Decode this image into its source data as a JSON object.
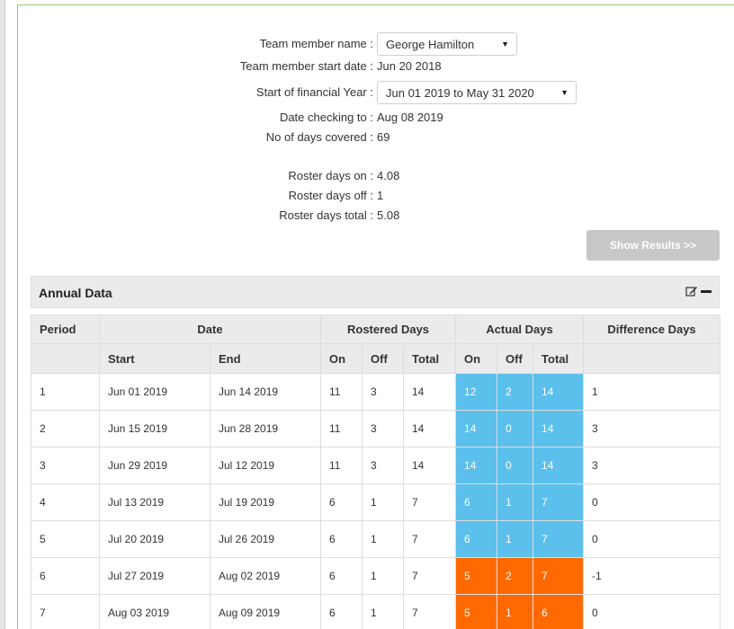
{
  "form": {
    "member_name_label": "Team member name :",
    "member_name_value": "George Hamilton",
    "start_date_label": "Team member start date :",
    "start_date_value": "Jun 20 2018",
    "financial_year_label": "Start of financial Year :",
    "financial_year_value": "Jun 01 2019 to May 31 2020",
    "date_checking_label": "Date checking to :",
    "date_checking_value": "Aug 08 2019",
    "days_covered_label": "No of days covered :",
    "days_covered_value": "69",
    "roster_on_label": "Roster days on :",
    "roster_on_value": "4.08",
    "roster_off_label": "Roster days off :",
    "roster_off_value": "1",
    "roster_total_label": "Roster days total :",
    "roster_total_value": "5.08",
    "caret_icon": "▼"
  },
  "buttons": {
    "show_results": "Show Results >>"
  },
  "panel": {
    "title": "Annual Data",
    "edit_icon": "edit-icon",
    "collapse_icon": "minus-icon"
  },
  "colors": {
    "actual_over": "#5bc0eb",
    "actual_under": "#ff6900",
    "frame": "#8fce6b"
  },
  "table": {
    "group_headers": {
      "period": "Period",
      "date": "Date",
      "rostered": "Rostered Days",
      "actual": "Actual Days",
      "difference": "Difference Days"
    },
    "sub_headers": {
      "start": "Start",
      "end": "End",
      "r_on": "On",
      "r_off": "Off",
      "r_total": "Total",
      "a_on": "On",
      "a_off": "Off",
      "a_total": "Total"
    },
    "rows": [
      {
        "period": "1",
        "start": "Jun 01 2019",
        "end": "Jun 14 2019",
        "r_on": "11",
        "r_off": "3",
        "r_total": "14",
        "a_on": "12",
        "a_off": "2",
        "a_total": "14",
        "diff": "1",
        "status": "blue"
      },
      {
        "period": "2",
        "start": "Jun 15 2019",
        "end": "Jun 28 2019",
        "r_on": "11",
        "r_off": "3",
        "r_total": "14",
        "a_on": "14",
        "a_off": "0",
        "a_total": "14",
        "diff": "3",
        "status": "blue"
      },
      {
        "period": "3",
        "start": "Jun 29 2019",
        "end": "Jul 12 2019",
        "r_on": "11",
        "r_off": "3",
        "r_total": "14",
        "a_on": "14",
        "a_off": "0",
        "a_total": "14",
        "diff": "3",
        "status": "blue"
      },
      {
        "period": "4",
        "start": "Jul 13 2019",
        "end": "Jul 19 2019",
        "r_on": "6",
        "r_off": "1",
        "r_total": "7",
        "a_on": "6",
        "a_off": "1",
        "a_total": "7",
        "diff": "0",
        "status": "blue"
      },
      {
        "period": "5",
        "start": "Jul 20 2019",
        "end": "Jul 26 2019",
        "r_on": "6",
        "r_off": "1",
        "r_total": "7",
        "a_on": "6",
        "a_off": "1",
        "a_total": "7",
        "diff": "0",
        "status": "blue"
      },
      {
        "period": "6",
        "start": "Jul 27 2019",
        "end": "Aug 02 2019",
        "r_on": "6",
        "r_off": "1",
        "r_total": "7",
        "a_on": "5",
        "a_off": "2",
        "a_total": "7",
        "diff": "-1",
        "status": "orange"
      },
      {
        "period": "7",
        "start": "Aug 03 2019",
        "end": "Aug 09 2019",
        "r_on": "6",
        "r_off": "1",
        "r_total": "7",
        "a_on": "5",
        "a_off": "1",
        "a_total": "6",
        "diff": "0",
        "status": "orange"
      }
    ]
  }
}
